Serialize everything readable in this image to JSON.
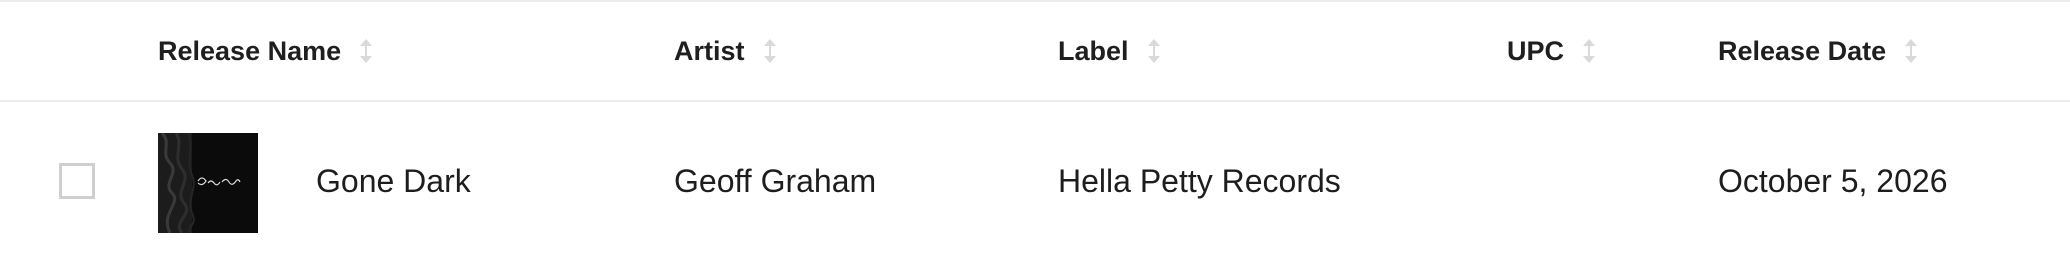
{
  "columns": {
    "release_name": "Release Name",
    "artist": "Artist",
    "label": "Label",
    "upc": "UPC",
    "release_date": "Release Date"
  },
  "rows": [
    {
      "release_name": "Gone Dark",
      "artist": "Geoff Graham",
      "label": "Hella Petty Records",
      "upc": "",
      "release_date": "October 5, 2026",
      "cover_art_icon": "album-cover-art",
      "checked": false
    }
  ],
  "colors": {
    "header_text": "#1f1f1f",
    "body_text": "#1d1d1d",
    "divider": "#ececec",
    "sort_icon": "#d6d6d6",
    "checkbox_border": "#cfcfcf",
    "cover_background": "#0b0b0b"
  }
}
